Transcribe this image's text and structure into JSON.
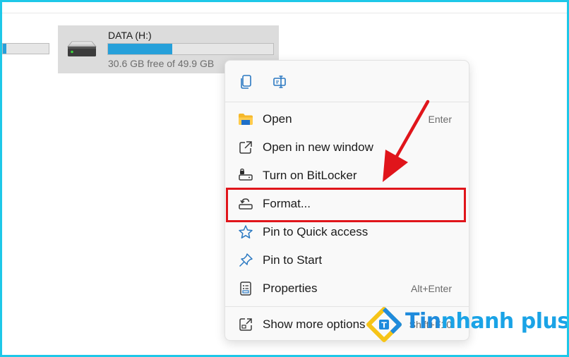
{
  "drive": {
    "name": "DATA (H:)",
    "free_text": "30.6 GB free of 49.9 GB",
    "used_fraction": 0.387,
    "icon": "hard-drive-icon"
  },
  "partial_drive": {
    "used_fraction": 0.07
  },
  "context_menu": {
    "quick_actions": [
      {
        "icon": "copy-icon"
      },
      {
        "icon": "rename-icon"
      }
    ],
    "items": [
      {
        "label": "Open",
        "shortcut": "Enter",
        "icon": "folder-icon"
      },
      {
        "label": "Open in new window",
        "shortcut": "",
        "icon": "new-window-icon"
      },
      {
        "label": "Turn on BitLocker",
        "shortcut": "",
        "icon": "bitlocker-icon"
      },
      {
        "label": "Format...",
        "shortcut": "",
        "icon": "format-icon"
      },
      {
        "label": "Pin to Quick access",
        "shortcut": "",
        "icon": "star-icon"
      },
      {
        "label": "Pin to Start",
        "shortcut": "",
        "icon": "pin-icon"
      },
      {
        "label": "Properties",
        "shortcut": "Alt+Enter",
        "icon": "properties-icon"
      },
      {
        "label": "Show more options",
        "shortcut": "Shift+F10",
        "icon": "more-options-icon"
      }
    ]
  },
  "annotation": {
    "highlight_color": "#e0151b",
    "arrow_color": "#e0151b"
  },
  "watermark": {
    "text_part1": "Tin",
    "text_part2": "nhanh plus"
  },
  "colors": {
    "accent": "#26a0da",
    "frame": "#1ec8e8"
  }
}
